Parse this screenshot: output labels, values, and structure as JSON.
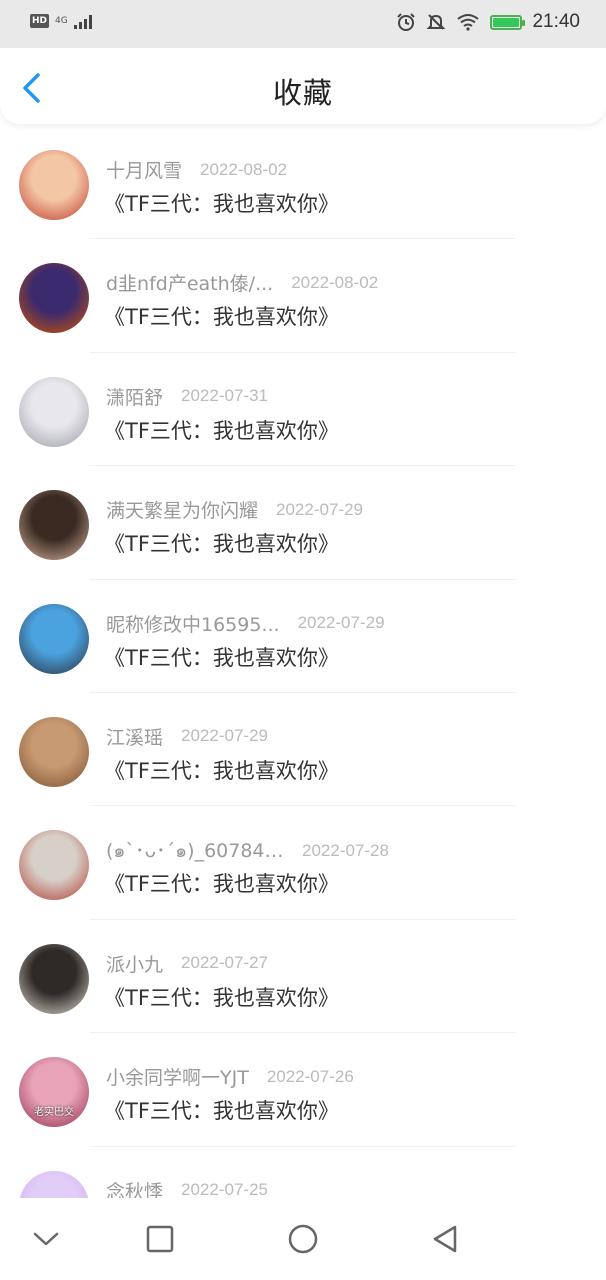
{
  "status_bar": {
    "hd": "HD",
    "network": "4G",
    "time": "21:40",
    "battery_level": 1.0,
    "battery_color": "#34c759"
  },
  "header": {
    "title": "收藏",
    "back_icon": "chevron-left-icon",
    "accent": "#2196f3"
  },
  "items": [
    {
      "username": "十月风雪",
      "date": "2022-08-02",
      "title": "《TF三代：我也喜欢你》",
      "avatar_colors": [
        "#f3c7a6",
        "#c0392b"
      ]
    },
    {
      "username": "d韭nfd产eath傣/...",
      "date": "2022-08-02",
      "title": "《TF三代：我也喜欢你》",
      "avatar_colors": [
        "#3b2a6e",
        "#d35400"
      ]
    },
    {
      "username": "潇陌舒",
      "date": "2022-07-31",
      "title": "《TF三代：我也喜欢你》",
      "avatar_colors": [
        "#e8e8ec",
        "#9a9aa6"
      ]
    },
    {
      "username": "满天繁星为你闪耀",
      "date": "2022-07-29",
      "title": "《TF三代：我也喜欢你》",
      "avatar_colors": [
        "#3a2a22",
        "#d8b7a0"
      ]
    },
    {
      "username": "昵称修改中16595...",
      "date": "2022-07-29",
      "title": "《TF三代：我也喜欢你》",
      "avatar_colors": [
        "#4aa3df",
        "#2b2b3a"
      ]
    },
    {
      "username": "江溪瑶",
      "date": "2022-07-29",
      "title": "《TF三代：我也喜欢你》",
      "avatar_colors": [
        "#c89a72",
        "#7a4e2e"
      ]
    },
    {
      "username": "(๑`･ᴗ･´๑)_607846...",
      "date": "2022-07-28",
      "title": "《TF三代：我也喜欢你》",
      "avatar_colors": [
        "#d7d0c8",
        "#b03a2e"
      ]
    },
    {
      "username": "派小九",
      "date": "2022-07-27",
      "title": "《TF三代：我也喜欢你》",
      "avatar_colors": [
        "#2e2a28",
        "#e6dcd2"
      ]
    },
    {
      "username": "小余同学啊一YJT",
      "date": "2022-07-26",
      "title": "《TF三代：我也喜欢你》",
      "avatar_colors": [
        "#e9a3b8",
        "#8e2c48"
      ],
      "avatar_caption": "老实巴交"
    },
    {
      "username": "念秋悸",
      "date": "2022-07-25",
      "title": "",
      "avatar_colors": [
        "#e2cdf7",
        "#c9a6f0"
      ]
    }
  ],
  "nav_bar": {
    "icons": [
      "chevron-down-icon",
      "square-icon",
      "circle-icon",
      "triangle-back-icon"
    ]
  }
}
